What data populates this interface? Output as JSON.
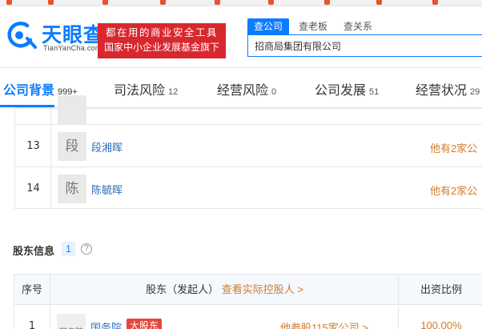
{
  "brand": {
    "logo_text": "天眼查",
    "logo_sub": "TianYanCha.com",
    "brand_color": "#0b7cff"
  },
  "slogan": {
    "line1": "都在用的商业安全工具",
    "line2": "国家中小企业发展基金旗下",
    "bg_color": "#d9272e"
  },
  "search": {
    "tabs": [
      "查公司",
      "查老板",
      "查关系"
    ],
    "active_tab": 0,
    "value": "招商局集团有限公司"
  },
  "nav": {
    "items": [
      {
        "label": "公司背景",
        "count": "999+"
      },
      {
        "label": "司法风险",
        "count": "12"
      },
      {
        "label": "经营风险",
        "count": "0"
      },
      {
        "label": "公司发展",
        "count": "51"
      },
      {
        "label": "经营状况",
        "count": "29"
      }
    ],
    "active": 0
  },
  "members": {
    "rows": [
      {
        "index": "",
        "avatar_char": "",
        "name": "",
        "other": ""
      },
      {
        "index": "13",
        "avatar_char": "段",
        "name": "段湘晖",
        "other": "他有2家公"
      },
      {
        "index": "14",
        "avatar_char": "陈",
        "name": "陈毓晖",
        "other": "他有2家公"
      }
    ]
  },
  "shareholders": {
    "title": "股东信息",
    "count": "1",
    "help": "?",
    "headers": {
      "index": "序号",
      "holder": "股东（发起人）",
      "holder_link": "查看实际控股人 >",
      "ratio": "出资比例"
    },
    "rows": [
      {
        "index": "1",
        "logo_text": "国务院",
        "name": "国务院",
        "badge": "大股东",
        "link": "他参股115家公司 >",
        "ratio": "100.00%"
      }
    ]
  }
}
